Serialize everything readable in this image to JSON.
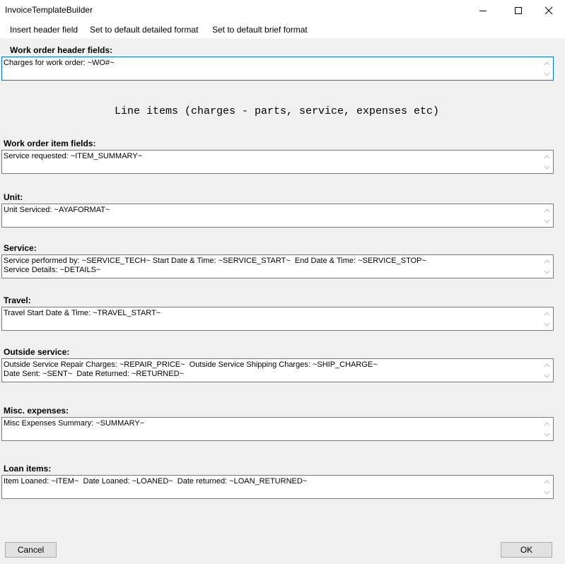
{
  "window": {
    "title": "InvoiceTemplateBuilder"
  },
  "menu": {
    "items": [
      "Insert header field",
      "Set to default detailed format",
      "Set to default brief format"
    ]
  },
  "header_section": {
    "label": "Work order header fields:",
    "value": "Charges for work order: ~WO#~"
  },
  "line_items_heading": "Line items (charges - parts, service, expenses etc)",
  "sections": {
    "item": {
      "label": "Work order item fields:",
      "value": "Service requested: ~ITEM_SUMMARY~"
    },
    "unit": {
      "label": "Unit:",
      "value": "Unit Serviced: ~AYAFORMAT~"
    },
    "service": {
      "label": "Service:",
      "value": "Service performed by: ~SERVICE_TECH~ Start Date & Time: ~SERVICE_START~  End Date & Time: ~SERVICE_STOP~\nService Details: ~DETAILS~"
    },
    "travel": {
      "label": "Travel:",
      "value": "Travel Start Date & Time: ~TRAVEL_START~"
    },
    "outside": {
      "label": "Outside service:",
      "value": "Outside Service Repair Charges: ~REPAIR_PRICE~  Outside Service Shipping Charges: ~SHIP_CHARGE~\nDate Sent: ~SENT~  Date Returned: ~RETURNED~"
    },
    "misc": {
      "label": "Misc. expenses:",
      "value": "Misc Expenses Summary: ~SUMMARY~"
    },
    "loan": {
      "label": "Loan items:",
      "value": "Item Loaned: ~ITEM~  Date Loaned: ~LOANED~  Date returned: ~LOAN_RETURNED~"
    }
  },
  "buttons": {
    "cancel": "Cancel",
    "ok": "OK"
  },
  "icons": {
    "minimize": "minimize-icon",
    "maximize": "maximize-icon",
    "close": "close-icon",
    "scroll_up": "chevron-up-icon",
    "scroll_down": "chevron-down-icon"
  },
  "colors": {
    "window_bg": "#f0f0f0",
    "focus_border": "#0078d7",
    "border": "#7a7a7a",
    "button_bg": "#e1e1e1"
  }
}
